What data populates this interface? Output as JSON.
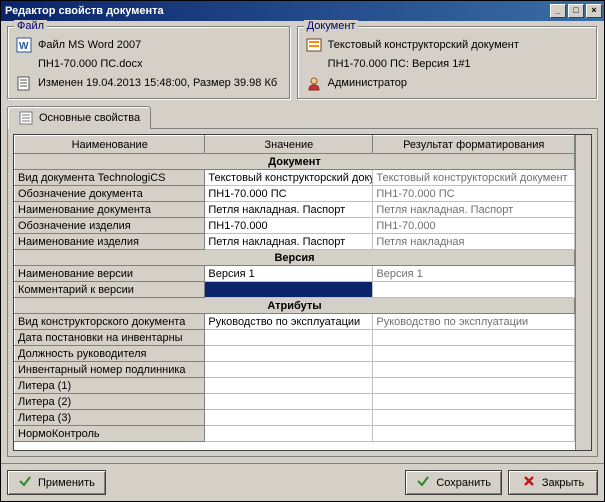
{
  "window": {
    "title": "Редактор свойств документа"
  },
  "file": {
    "legend": "Файл",
    "name": "Файл MS Word 2007",
    "path": "ПН1-70.000 ПС.docx",
    "info": "Изменен 19.04.2013 15:48:00, Размер 39.98 Кб"
  },
  "document": {
    "legend": "Документ",
    "name": "Текстовый конструкторский документ",
    "version": "ПН1-70.000 ПС: Версия 1#1",
    "user": "Администратор"
  },
  "tabs": {
    "main": "Основные свойства"
  },
  "columns": {
    "name": "Наименование",
    "value": "Значение",
    "result": "Результат форматирования"
  },
  "sections": {
    "document": "Документ",
    "version": "Версия",
    "attributes": "Атрибуты"
  },
  "rows": {
    "doc": [
      {
        "name": "Вид документа TechnologiCS",
        "value": "Текстовый конструкторский докум",
        "result": "Текстовый конструкторский документ"
      },
      {
        "name": "Обозначение документа",
        "value": "ПН1-70.000 ПС",
        "result": "ПН1-70.000 ПС"
      },
      {
        "name": "Наименование документа",
        "value": "Петля накладная. Паспорт",
        "result": "Петля накладная. Паспорт"
      },
      {
        "name": "Обозначение изделия",
        "value": "ПН1-70.000",
        "result": "ПН1-70.000"
      },
      {
        "name": "Наименование изделия",
        "value": "Петля накладная. Паспорт",
        "result": "Петля накладная"
      }
    ],
    "ver": [
      {
        "name": "Наименование версии",
        "value": "Версия 1",
        "result": "Версия 1"
      },
      {
        "name": "Комментарий к версии",
        "value": "",
        "result": ""
      }
    ],
    "attr": [
      {
        "name": "Вид конструкторского документа",
        "value": "Руководство по эксплуатации",
        "result": "Руководство по эксплуатации"
      },
      {
        "name": "Дата постановки на инвентарны",
        "value": "",
        "result": ""
      },
      {
        "name": "Должность руководителя",
        "value": "",
        "result": ""
      },
      {
        "name": "Инвентарный номер подлинника",
        "value": "",
        "result": ""
      },
      {
        "name": "Литера (1)",
        "value": "",
        "result": ""
      },
      {
        "name": "Литера (2)",
        "value": "",
        "result": ""
      },
      {
        "name": "Литера (3)",
        "value": "",
        "result": ""
      },
      {
        "name": "НормоКонтроль",
        "value": "",
        "result": ""
      }
    ]
  },
  "buttons": {
    "apply": "Применить",
    "save": "Сохранить",
    "close": "Закрыть"
  }
}
